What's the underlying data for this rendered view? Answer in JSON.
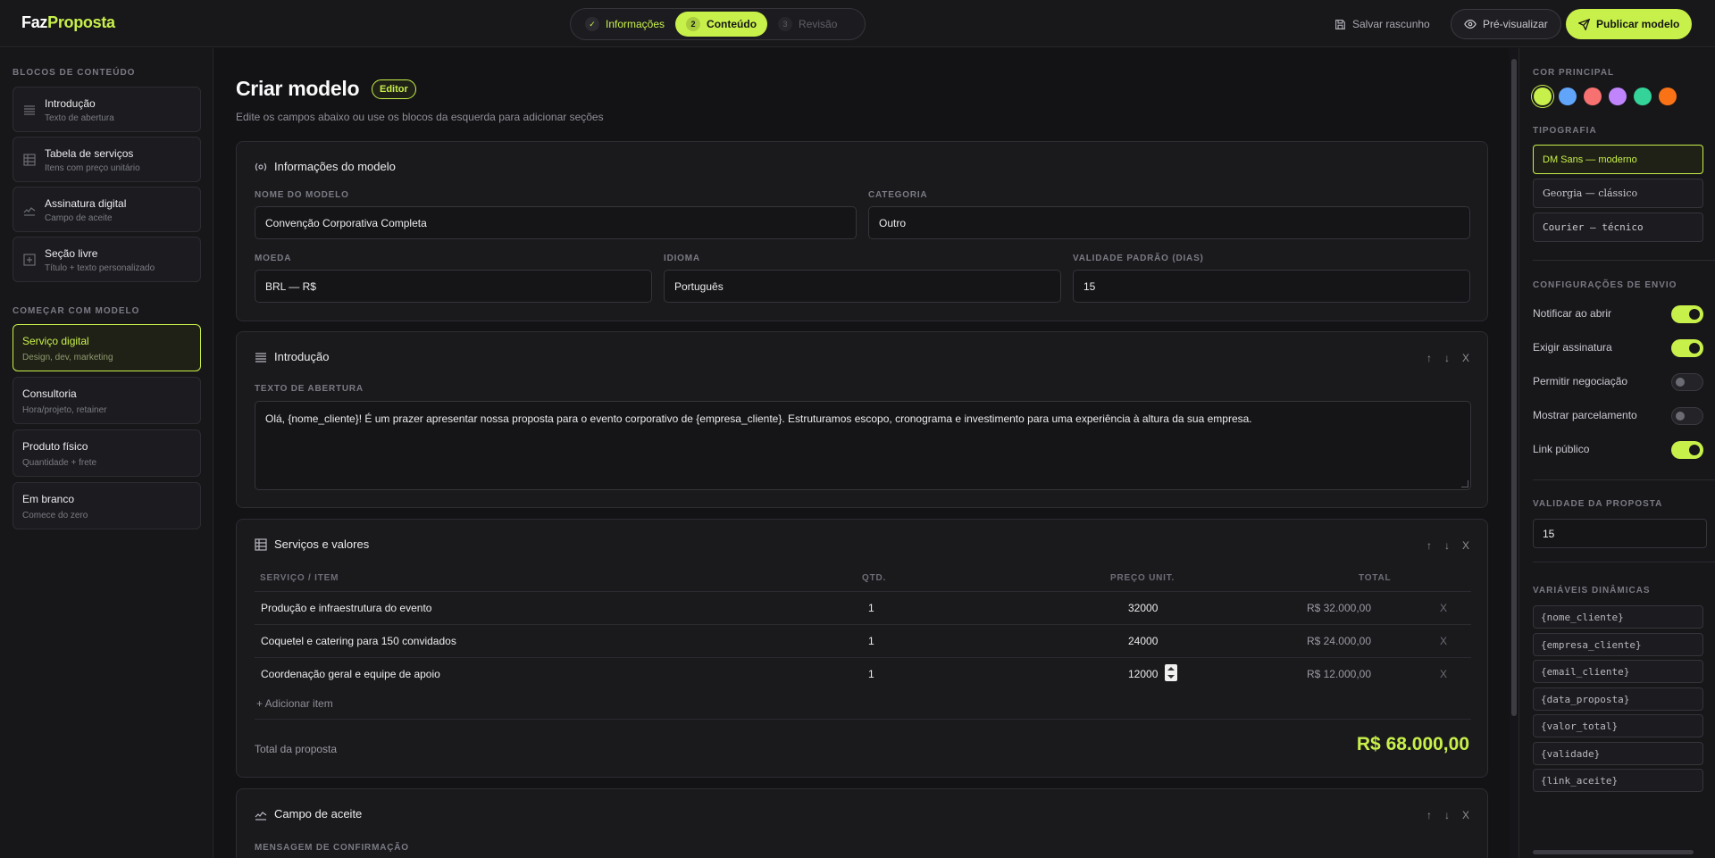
{
  "header": {
    "logo_part1": "Faz",
    "logo_part2": "Proposta",
    "steps": [
      {
        "num": "✓",
        "label": "Informações",
        "state": "done"
      },
      {
        "num": "2",
        "label": "Conteúdo",
        "state": "active"
      },
      {
        "num": "3",
        "label": "Revisão",
        "state": "todo"
      }
    ],
    "save_label": "Salvar rascunho",
    "preview_label": "Pré-visualizar",
    "publish_label": "Publicar modelo"
  },
  "sidebar": {
    "blocks_heading": "BLOCOS DE CONTEÚDO",
    "blocks": [
      {
        "title": "Introdução",
        "sub": "Texto de abertura",
        "icon": "lines-icon"
      },
      {
        "title": "Tabela de serviços",
        "sub": "Itens com preço unitário",
        "icon": "table-icon"
      },
      {
        "title": "Assinatura digital",
        "sub": "Campo de aceite",
        "icon": "signature-icon"
      },
      {
        "title": "Seção livre",
        "sub": "Título + texto personalizado",
        "icon": "plus-square-icon"
      }
    ],
    "templates_heading": "COMEÇAR COM MODELO",
    "templates": [
      {
        "title": "Serviço digital",
        "sub": "Design, dev, marketing",
        "selected": true
      },
      {
        "title": "Consultoria",
        "sub": "Hora/projeto, retainer",
        "selected": false
      },
      {
        "title": "Produto físico",
        "sub": "Quantidade + frete",
        "selected": false
      },
      {
        "title": "Em branco",
        "sub": "Comece do zero",
        "selected": false
      }
    ]
  },
  "main": {
    "title": "Criar modelo",
    "badge": "Editor",
    "subtitle": "Edite os campos abaixo ou use os blocos da esquerda para adicionar seções",
    "info_panel": {
      "title": "Informações do modelo",
      "name_label": "NOME DO MODELO",
      "name_value": "Convenção Corporativa Completa",
      "category_label": "CATEGORIA",
      "category_value": "Outro",
      "currency_label": "MOEDA",
      "currency_value": "BRL — R$",
      "language_label": "IDIOMA",
      "language_value": "Português",
      "validity_label": "VALIDADE PADRÃO (DIAS)",
      "validity_value": "15"
    },
    "intro_panel": {
      "title": "Introdução",
      "label": "TEXTO DE ABERTURA",
      "text": "Olá, {nome_cliente}! É um prazer apresentar nossa proposta para o evento corporativo de {empresa_cliente}. Estruturamos escopo, cronograma e investimento para uma experiência à altura da sua empresa.",
      "ctrl_up": "↑",
      "ctrl_down": "↓",
      "ctrl_remove": "X"
    },
    "services_panel": {
      "title": "Serviços e valores",
      "columns": [
        "SERVIÇO / ITEM",
        "QTD.",
        "PREÇO UNIT.",
        "TOTAL"
      ],
      "rows": [
        {
          "item": "Produção e infraestrutura do evento",
          "qty": "1",
          "price": "32000",
          "total": "R$ 32.000,00",
          "remove": "X"
        },
        {
          "item": "Coquetel e catering para 150 convidados",
          "qty": "1",
          "price": "24000",
          "total": "R$ 24.000,00",
          "remove": "X"
        },
        {
          "item": "Coordenação geral e equipe de apoio",
          "qty": "1",
          "price": "12000",
          "total": "R$ 12.000,00",
          "remove": "X"
        }
      ],
      "add_item": "+ Adicionar item",
      "total_label": "Total da proposta",
      "total_value": "R$ 68.000,00",
      "ctrl_up": "↑",
      "ctrl_down": "↓",
      "ctrl_remove": "X"
    },
    "accept_panel": {
      "title": "Campo de aceite",
      "label": "MENSAGEM DE CONFIRMAÇÃO",
      "ctrl_up": "↑",
      "ctrl_down": "↓",
      "ctrl_remove": "X"
    }
  },
  "right_panel": {
    "color_heading": "COR PRINCIPAL",
    "colors": [
      "#c8f04a",
      "#60a5fa",
      "#f87171",
      "#c084fc",
      "#34d399",
      "#f97316"
    ],
    "selected_color": "#c8f04a",
    "typography_heading": "TIPOGRAFIA",
    "fonts": [
      {
        "label": "DM Sans — moderno",
        "selected": true
      },
      {
        "label": "Georgia — clássico",
        "selected": false
      },
      {
        "label": "Courier — técnico",
        "selected": false
      }
    ],
    "send_heading": "CONFIGURAÇÕES DE ENVIO",
    "toggles": [
      {
        "label": "Notificar ao abrir",
        "on": true
      },
      {
        "label": "Exigir assinatura",
        "on": true
      },
      {
        "label": "Permitir negociação",
        "on": false
      },
      {
        "label": "Mostrar parcelamento",
        "on": false
      },
      {
        "label": "Link público",
        "on": true
      }
    ],
    "validity_heading": "VALIDADE DA PROPOSTA",
    "validity_value": "15",
    "vars_heading": "VARIÁVEIS DINÂMICAS",
    "variables": [
      "{nome_cliente}",
      "{empresa_cliente}",
      "{email_cliente}",
      "{data_proposta}",
      "{valor_total}",
      "{validade}",
      "{link_aceite}"
    ]
  }
}
